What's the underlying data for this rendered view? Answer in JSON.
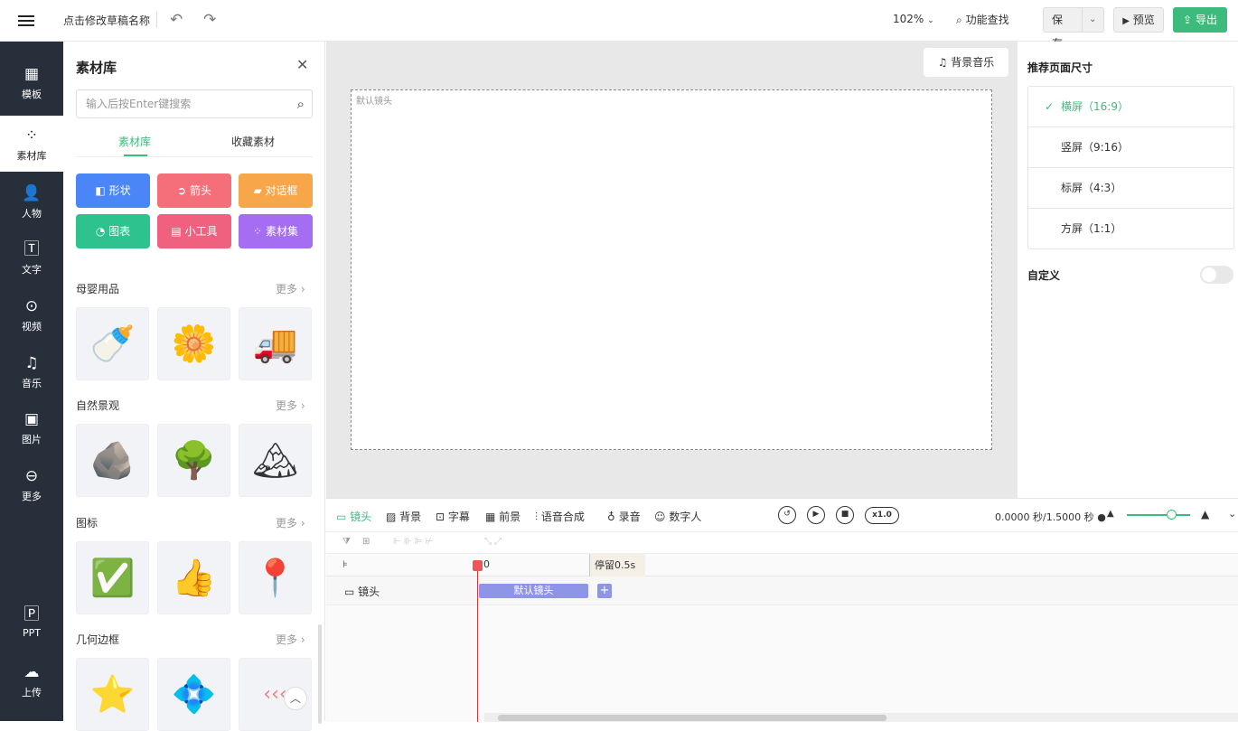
{
  "topbar": {
    "draft_name": "点击修改草稿名称",
    "zoom": "102%",
    "find_label": "功能查找",
    "save_label": "保存",
    "preview_label": "预览",
    "export_label": "导出",
    "export_color": "#3dbb7d"
  },
  "leftnav": {
    "items": [
      {
        "label": "模板",
        "icon": "template-icon"
      },
      {
        "label": "素材库",
        "icon": "material-icon",
        "active": true
      },
      {
        "label": "人物",
        "icon": "person-icon"
      },
      {
        "label": "文字",
        "icon": "text-icon"
      },
      {
        "label": "视频",
        "icon": "video-icon"
      },
      {
        "label": "音乐",
        "icon": "music-icon"
      },
      {
        "label": "图片",
        "icon": "image-icon"
      },
      {
        "label": "更多",
        "icon": "more-icon"
      },
      {
        "label": "PPT",
        "icon": "ppt-icon"
      },
      {
        "label": "上传",
        "icon": "upload-icon"
      }
    ]
  },
  "panel": {
    "title": "素材库",
    "search_placeholder": "输入后按Enter键搜索",
    "tabs": [
      "素材库",
      "收藏素材"
    ],
    "categories": [
      {
        "label": "形状",
        "color": "#4a86f7"
      },
      {
        "label": "箭头",
        "color": "#f56f7a"
      },
      {
        "label": "对话框",
        "color": "#f7a64a"
      },
      {
        "label": "图表",
        "color": "#2ec28e"
      },
      {
        "label": "小工具",
        "color": "#f0607f"
      },
      {
        "label": "素材集",
        "color": "#a46df2"
      }
    ],
    "more_label": "更多",
    "sections": [
      {
        "title": "母婴用品",
        "items": [
          "baby-bottle",
          "rattle-toy",
          "toy-truck"
        ]
      },
      {
        "title": "自然景观",
        "items": [
          "rock",
          "grass-field",
          "snow-mountain"
        ]
      },
      {
        "title": "图标",
        "items": [
          "check-circle",
          "thumbs-up",
          "location-pin"
        ]
      },
      {
        "title": "几何边框",
        "items": [
          "star-frame",
          "hexagon-frame",
          "arrow-frame"
        ]
      }
    ]
  },
  "canvas": {
    "bgm_label": "背景音乐",
    "scene_label": "默认镜头"
  },
  "rightpanel": {
    "title": "推荐页面尺寸",
    "sizes": [
      "横屏（16:9）",
      "竖屏（9:16）",
      "标屏（4:3）",
      "方屏（1:1）"
    ],
    "selected_index": 0,
    "custom_label": "自定义",
    "custom_enabled": false
  },
  "timeline": {
    "tabs": [
      "镜头",
      "背景",
      "字幕",
      "前景",
      "语音合成",
      "录音",
      "数字人"
    ],
    "speed": "x1.0",
    "time": "0.0000 秒/1.5000 秒",
    "ruler_zero": "0",
    "pause_label": "停留0.5s",
    "track_label": "镜头",
    "clip_label": "默认镜头",
    "zoom_level": 0.62
  }
}
